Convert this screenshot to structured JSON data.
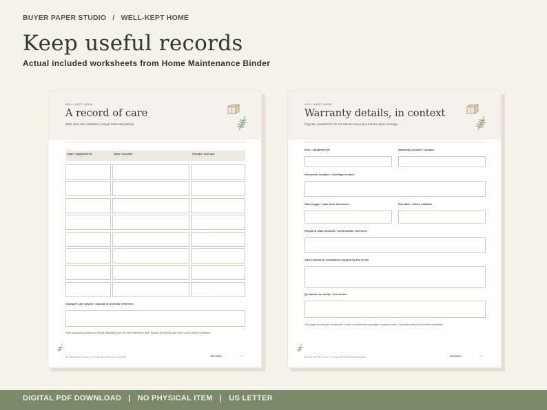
{
  "header": {
    "brand": "BUYER PAPER STUDIO",
    "separator": "/",
    "collection": "WELL-KEPT HOME",
    "headline": "Keep useful records",
    "subhead": "Actual included worksheets from Home Maintenance Binder"
  },
  "page1": {
    "kicker": "WELL-KEPT HOME",
    "title": "A record of care",
    "subtitle": "Write what was completed, not just what was planned.",
    "columns": [
      "Date / equipment ID",
      "Work / provider",
      "Receipt / next due"
    ],
    "row_count": 8,
    "section_label": "Changed care advice / manual or provider reference",
    "note": "Save supporting invoices or reports separately and use brief references here. Update the annual plan when a next date is confirmed.",
    "footer_brand": "BUYER PAPER STUDIO  |  HOME MAINTENANCE BINDER",
    "footer_section": "RECORDS",
    "page_number": "09"
  },
  "page2": {
    "kicker": "WELL-KEPT HOME",
    "title": "Warranty details, in context",
    "subtitle": "Copy the actual terms; do not assume every item has the same coverage.",
    "fields": {
      "item": "Item / equipment ID",
      "provider": "Warranty provider / contact",
      "document": "Document location / coverage section",
      "start": "Start trigger / date from document",
      "end": "End date / notice deadline",
      "claim": "Required claim method / confirmation reference",
      "care": "Care records or conditions required by the terms",
      "questions": "Questions to clarify / next action"
    },
    "note": "This page records your documents; it does not determine coverage or submit a claim. Calendar notes do not extend deadlines.",
    "footer_brand": "BUYER PAPER STUDIO  |  HOME MAINTENANCE BINDER",
    "footer_section": "RECORDS",
    "page_number": "02"
  },
  "banner": {
    "text": "DIGITAL PDF DOWNLOAD   |   NO PHYSICAL ITEM   |   US LETTER"
  },
  "colors": {
    "background": "#f5f2ea",
    "banner": "#7a8967",
    "title_text": "#2f3a2d",
    "sheet_header": "#f4f2ea"
  },
  "icons": [
    "box-icon",
    "leaf-icon"
  ]
}
